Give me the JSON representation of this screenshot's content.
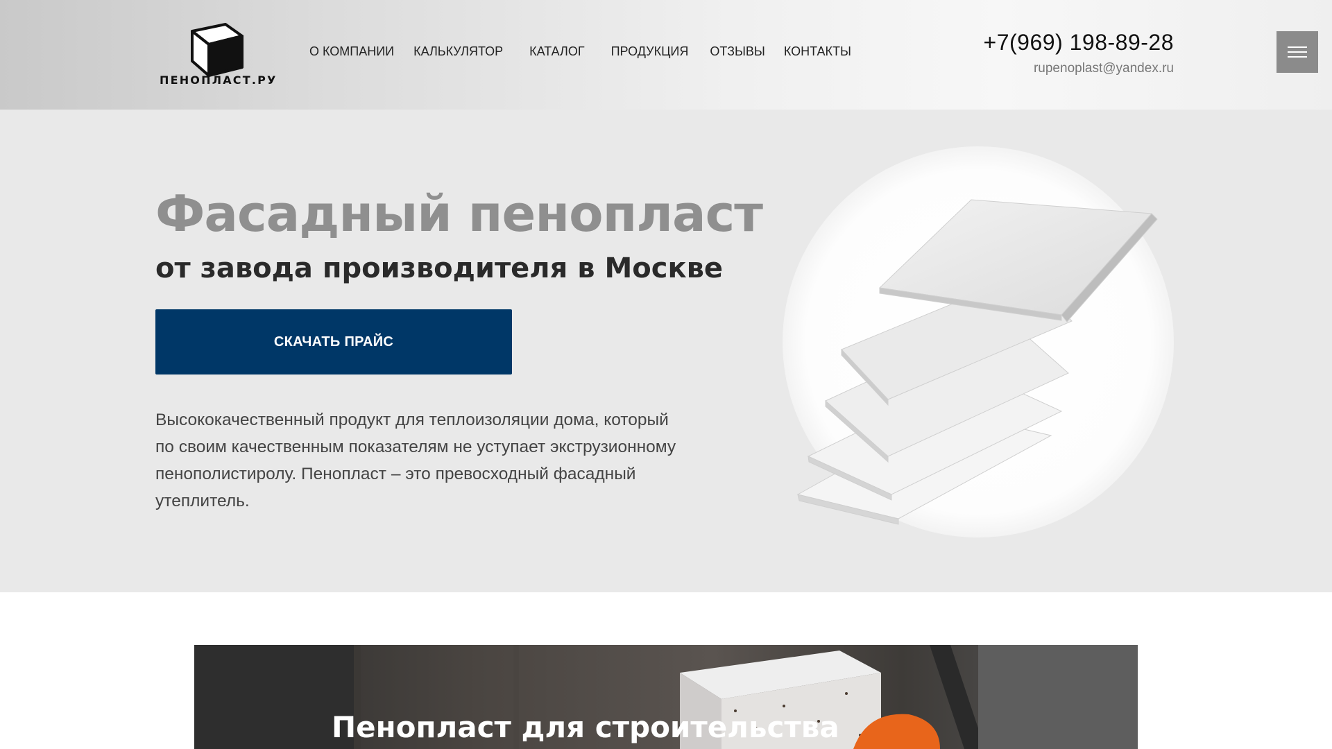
{
  "header": {
    "logo_text": "ПЕНОПЛАСТ.РУ",
    "nav": [
      {
        "label": "О компании"
      },
      {
        "label": "Калькулятор"
      },
      {
        "label": "Каталог"
      },
      {
        "label": "Продукция"
      },
      {
        "label": "Отзывы"
      },
      {
        "label": "Контакты"
      }
    ],
    "phone": "+7(969) 198-89-28",
    "email": "rupenoplast@yandex.ru",
    "menu_icon": "hamburger-icon"
  },
  "hero": {
    "title": "Фасадный пенопласт",
    "subtitle": "от завода производителя в Москве",
    "cta_label": "Скачать прайс",
    "description": "Высококачественный продукт для теплоизоляции дома, который по своим качественным показателям не уступает экструзионному пенополистиролу. Пенопласт – это превосходный фасадный утеплитель.",
    "image": "foam-sheets-image"
  },
  "promo": {
    "title": "Пенопласт для строительства"
  },
  "colors": {
    "accent": "#003767",
    "title_gray": "#8f8f8f",
    "hero_bg": "#e9e9e9",
    "burger_bg": "#8b8b8b"
  }
}
